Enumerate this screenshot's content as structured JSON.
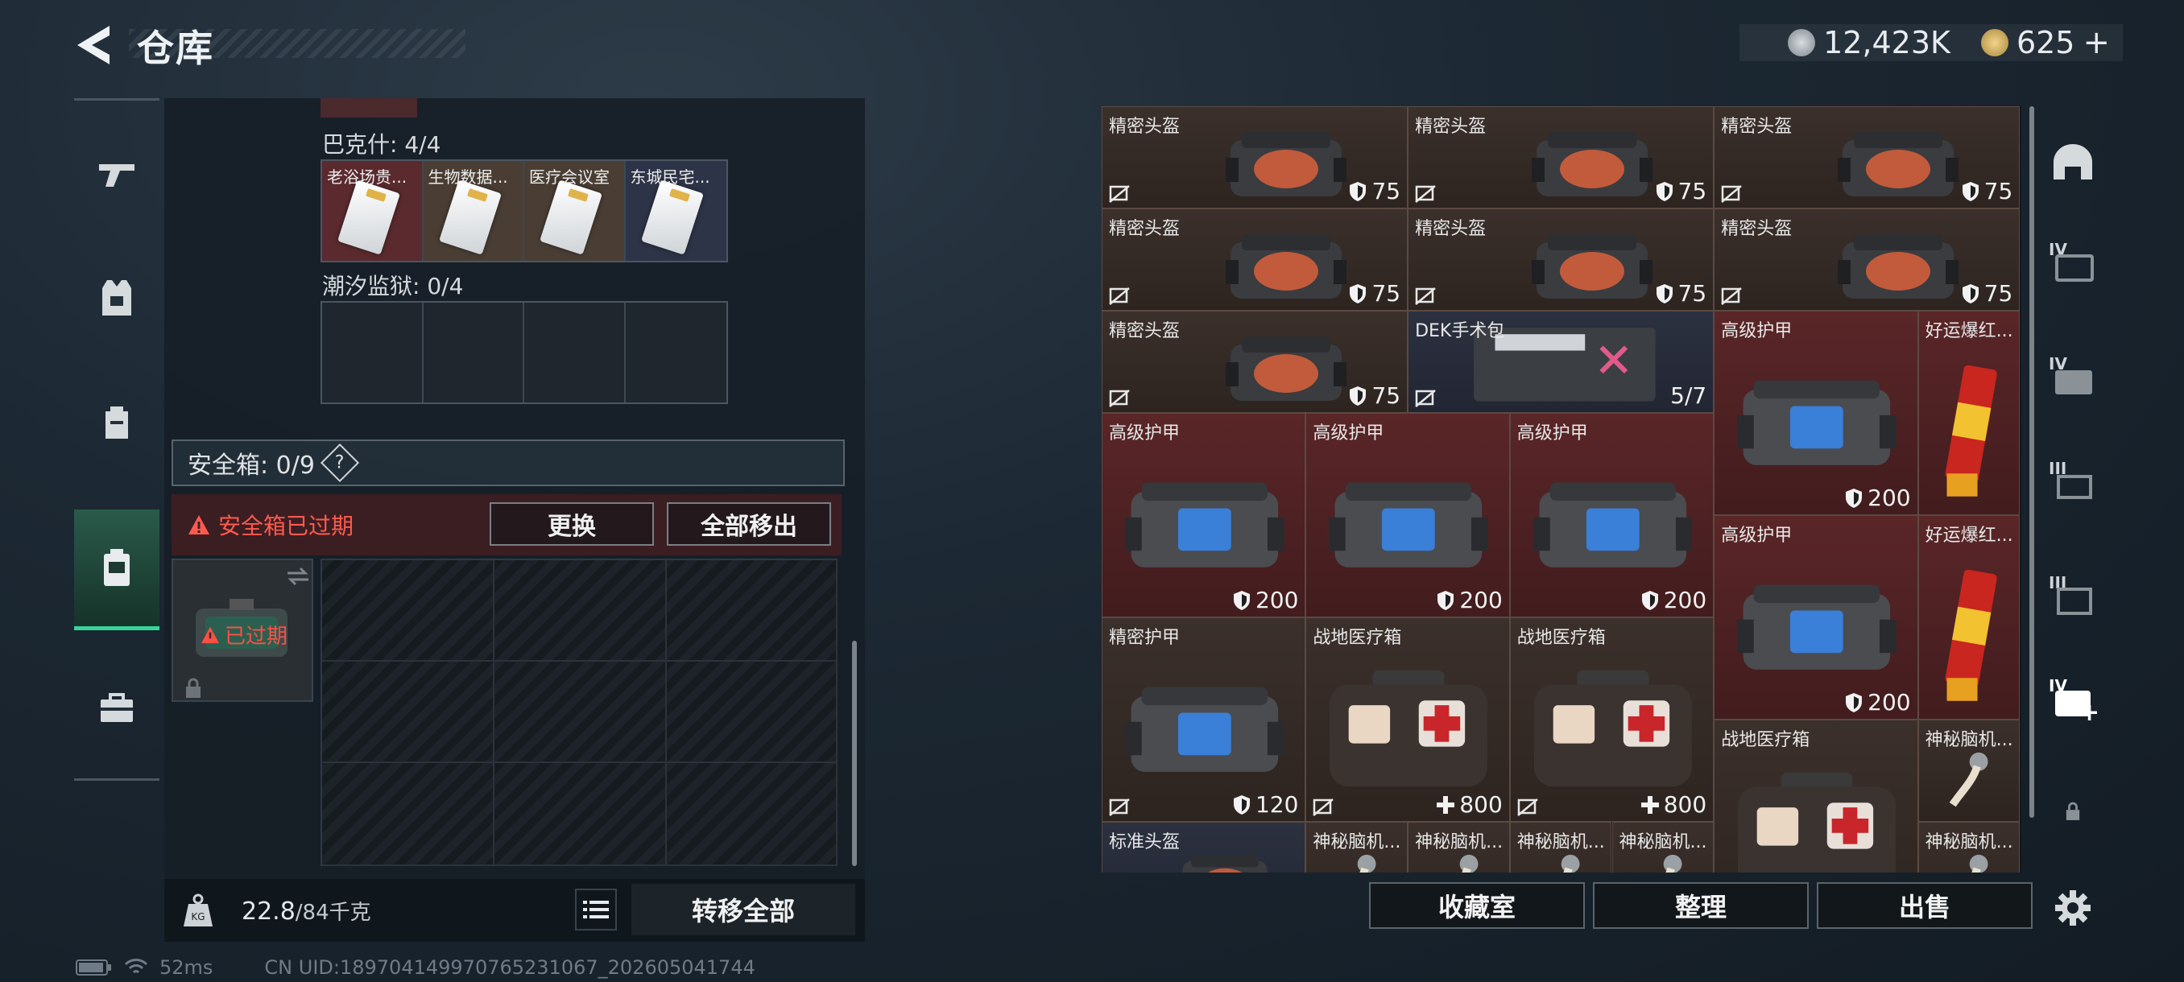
{
  "header": {
    "title": "仓库"
  },
  "currency": {
    "primary": "12,423K",
    "secondary": "625"
  },
  "left": {
    "group1_label": "巴克什: 4/4",
    "group1_items": [
      "老浴场贵...",
      "生物数据...",
      "医疗会议室",
      "东城民宅..."
    ],
    "group2_label": "潮汐监狱: 0/4",
    "safebox_label": "安全箱: 0/9",
    "help": "?",
    "expired_warning": "安全箱已过期",
    "replace_btn": "更换",
    "remove_all_btn": "全部移出",
    "safe_expired_tag": "已过期",
    "weight_value": "22.8",
    "weight_max": "/84千克",
    "transfer_all_btn": "转移全部"
  },
  "storage": {
    "items": [
      {
        "name": "精密头盔",
        "value": "75",
        "kind": "helmet"
      },
      {
        "name": "精密头盔",
        "value": "75",
        "kind": "helmet"
      },
      {
        "name": "精密头盔",
        "value": "75",
        "kind": "helmet"
      },
      {
        "name": "精密头盔",
        "value": "75",
        "kind": "helmet"
      },
      {
        "name": "精密头盔",
        "value": "75",
        "kind": "helmet"
      },
      {
        "name": "精密头盔",
        "value": "75",
        "kind": "helmet"
      },
      {
        "name": "精密头盔",
        "value": "75",
        "kind": "helmet"
      },
      {
        "name": "DEK手术包",
        "value": "5/7",
        "kind": "surgery"
      },
      {
        "name": "高级护甲",
        "value": "200",
        "kind": "armor"
      },
      {
        "name": "好运爆红...",
        "value": "",
        "kind": "firecracker"
      },
      {
        "name": "高级护甲",
        "value": "200",
        "kind": "armor"
      },
      {
        "name": "高级护甲",
        "value": "200",
        "kind": "armor"
      },
      {
        "name": "高级护甲",
        "value": "200",
        "kind": "armor"
      },
      {
        "name": "高级护甲",
        "value": "200",
        "kind": "armor"
      },
      {
        "name": "好运爆红...",
        "value": "",
        "kind": "firecracker"
      },
      {
        "name": "精密护甲",
        "value": "120",
        "kind": "armor"
      },
      {
        "name": "战地医疗箱",
        "value": "800",
        "kind": "medkit"
      },
      {
        "name": "战地医疗箱",
        "value": "800",
        "kind": "medkit"
      },
      {
        "name": "战地医疗箱",
        "value": "",
        "kind": "medkit"
      },
      {
        "name": "神秘脑机...",
        "value": "",
        "kind": "chip"
      },
      {
        "name": "标准头盔",
        "value": "",
        "kind": "helmet"
      },
      {
        "name": "神秘脑机...",
        "value": "",
        "kind": "chip"
      },
      {
        "name": "神秘脑机...",
        "value": "",
        "kind": "chip"
      },
      {
        "name": "神秘脑机...",
        "value": "",
        "kind": "chip"
      },
      {
        "name": "神秘脑机...",
        "value": "",
        "kind": "chip"
      },
      {
        "name": "神秘脑机...",
        "value": "",
        "kind": "chip"
      }
    ]
  },
  "rail": {
    "labels": [
      "IV",
      "IV",
      "III",
      "III",
      "IV"
    ]
  },
  "actions": {
    "collection": "收藏室",
    "organize": "整理",
    "sell": "出售"
  },
  "status": {
    "ping": "52ms",
    "uid": "CN UID:1897041499707652310​67_202605041744"
  }
}
